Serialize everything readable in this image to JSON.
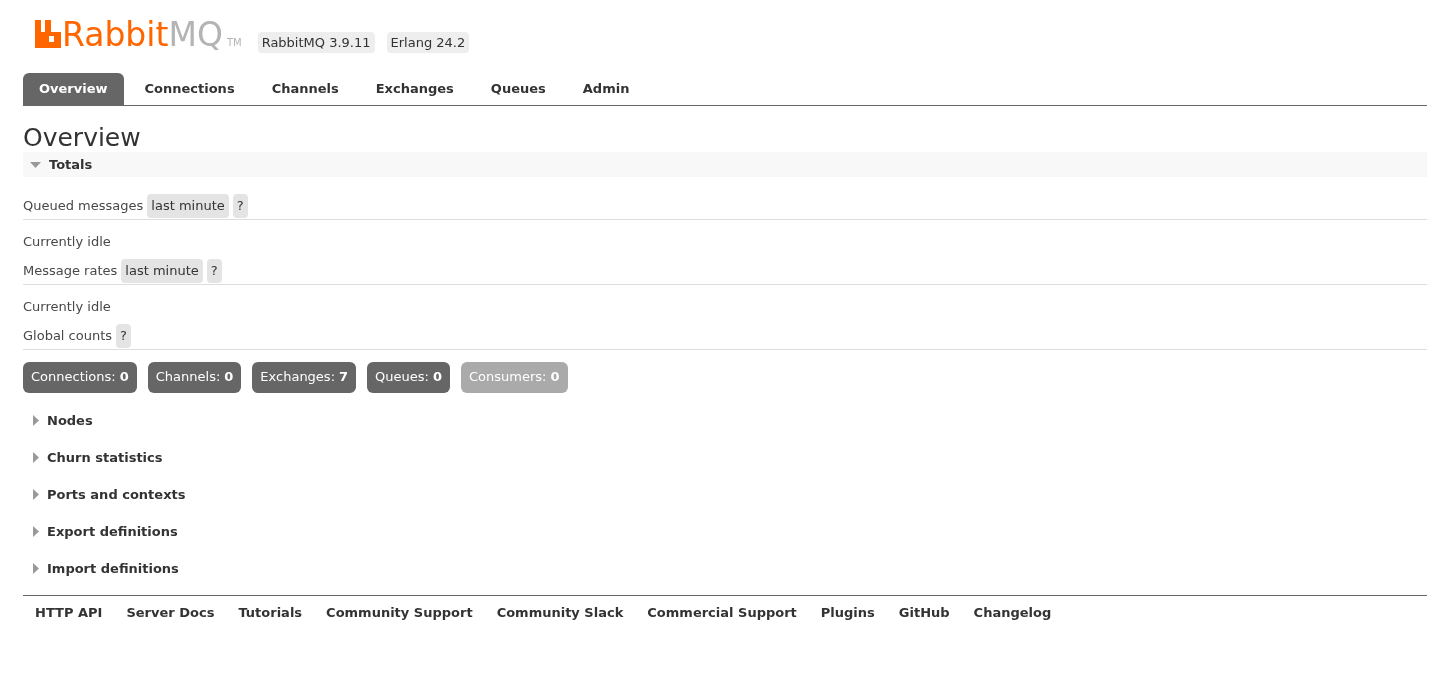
{
  "logo": {
    "brand": "Rabbit",
    "suffix": "MQ",
    "mark": "TM"
  },
  "versions": [
    "RabbitMQ 3.9.11",
    "Erlang 24.2"
  ],
  "tabs": [
    {
      "label": "Overview",
      "selected": true
    },
    {
      "label": "Connections",
      "selected": false
    },
    {
      "label": "Channels",
      "selected": false
    },
    {
      "label": "Exchanges",
      "selected": false
    },
    {
      "label": "Queues",
      "selected": false
    },
    {
      "label": "Admin",
      "selected": false
    }
  ],
  "page_title": "Overview",
  "totals": {
    "title": "Totals",
    "expanded": true,
    "blocks": [
      {
        "label": "Queued messages",
        "range": "last minute",
        "help": "?",
        "status": "Currently idle"
      },
      {
        "label": "Message rates",
        "range": "last minute",
        "help": "?",
        "status": "Currently idle"
      },
      {
        "label": "Global counts",
        "help": "?"
      }
    ],
    "counts": [
      {
        "label": "Connections:",
        "value": "0",
        "disabled": false
      },
      {
        "label": "Channels:",
        "value": "0",
        "disabled": false
      },
      {
        "label": "Exchanges:",
        "value": "7",
        "disabled": false
      },
      {
        "label": "Queues:",
        "value": "0",
        "disabled": false
      },
      {
        "label": "Consumers:",
        "value": "0",
        "disabled": true
      }
    ]
  },
  "sections": [
    {
      "title": "Nodes",
      "expanded": false
    },
    {
      "title": "Churn statistics",
      "expanded": false
    },
    {
      "title": "Ports and contexts",
      "expanded": false
    },
    {
      "title": "Export definitions",
      "expanded": false
    },
    {
      "title": "Import definitions",
      "expanded": false
    }
  ],
  "footer_links": [
    "HTTP API",
    "Server Docs",
    "Tutorials",
    "Community Support",
    "Community Slack",
    "Commercial Support",
    "Plugins",
    "GitHub",
    "Changelog"
  ]
}
